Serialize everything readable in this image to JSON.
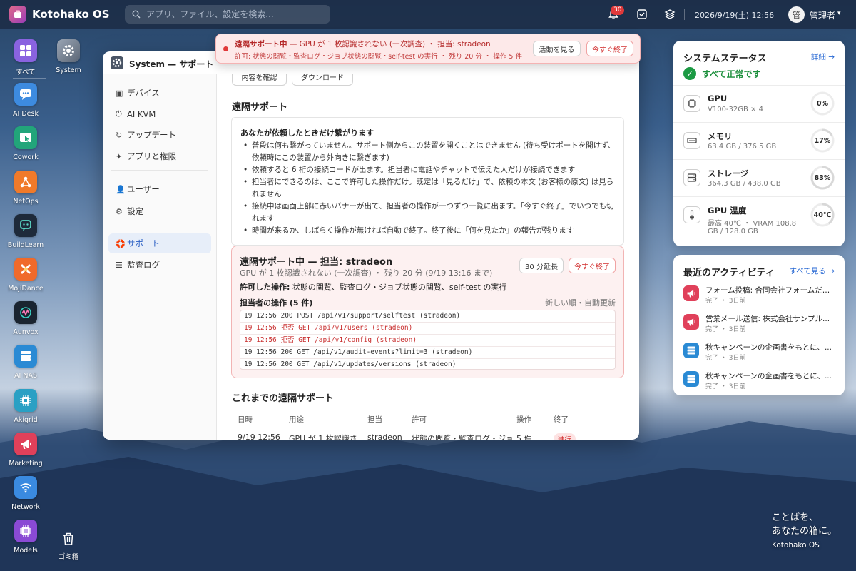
{
  "os": {
    "brand": "Kotohako OS",
    "search_placeholder": "アプリ、ファイル、設定を検索...",
    "notif_count": "30",
    "clock": "2026/9/19(土) 12:56",
    "user_avatar": "管",
    "user_name": "管理者"
  },
  "desktop": {
    "system_icon": "System",
    "trash": "ゴミ箱",
    "slogan_line1": "ことばを、",
    "slogan_line2": "あなたの箱に。",
    "slogan_sub": "Kotohako OS"
  },
  "dock": [
    {
      "label": "すべて",
      "icon": "grid-icon",
      "color": "#8a63e0"
    },
    {
      "label": "AI Desk",
      "icon": "chat-icon",
      "color": "#3d8be0"
    },
    {
      "label": "Cowork",
      "icon": "cursor-icon",
      "color": "#22a57a"
    },
    {
      "label": "NetOps",
      "icon": "network-icon",
      "color": "#f07a2a"
    },
    {
      "label": "BuildLearn",
      "icon": "build-icon",
      "color": "#1e2a3a"
    },
    {
      "label": "MojiDance",
      "icon": "dance-icon",
      "color": "#f06a2a"
    },
    {
      "label": "Aunvox",
      "icon": "wave-icon",
      "color": "#1a2430"
    },
    {
      "label": "AI NAS",
      "icon": "nas-icon",
      "color": "#2a8ad4"
    },
    {
      "label": "Akigrid",
      "icon": "chip-icon",
      "color": "#2aa0c4"
    },
    {
      "label": "Marketing",
      "icon": "megaphone-icon",
      "color": "#e0405a"
    },
    {
      "label": "Network",
      "icon": "wifi-icon",
      "color": "#3a8ae0"
    },
    {
      "label": "Models",
      "icon": "cpu-icon",
      "color": "#8a4ad4"
    }
  ],
  "banner": {
    "title": "遠隔サポート中",
    "text": " — GPU が 1 枚認識されない (一次調査) ・ 担当: stradeon",
    "line2": "許可: 状態の閲覧・監査ログ・ジョブ状態の閲覧・self-test の実行 ・ 残り 20 分 ・ 操作 5 件",
    "view_btn": "活動を見る",
    "end_btn": "今すぐ終了"
  },
  "window": {
    "title": "System — サポート"
  },
  "sidebar": {
    "items": [
      {
        "label": "デバイス",
        "icon": "▣"
      },
      {
        "label": "AI KVM",
        "icon": "⏻"
      },
      {
        "label": "アップデート",
        "icon": "↻"
      },
      {
        "label": "アプリと権限",
        "icon": "✦"
      },
      {
        "label": "ユーザー",
        "icon": "👤"
      },
      {
        "label": "設定",
        "icon": "⚙"
      },
      {
        "label": "サポート",
        "icon": "🛟"
      },
      {
        "label": "監査ログ",
        "icon": "☰"
      }
    ]
  },
  "main": {
    "top_btn1": "内容を確認",
    "top_btn2": "ダウンロード",
    "section_title": "遠隔サポート",
    "info_title": "あなたが依頼したときだけ繋がります",
    "bullets": [
      "普段は何も繋がっていません。サポート側からこの装置を開くことはできません (待ち受けポートを開けず、依頼時にこの装置から外向きに繋ぎます)",
      "依頼すると 6 桁の接続コードが出ます。担当者に電話やチャットで伝えた人だけが接続できます",
      "担当者にできるのは、ここで許可した操作だけ。既定は「見るだけ」で、依頼の本文 (お客様の原文) は見られません",
      "接続中は画面上部に赤いバナーが出て、担当者の操作が一つずつ一覧に出ます。「今すぐ終了」でいつでも切れます",
      "時間が来るか、しばらく操作が無ければ自動で終了。終了後に「何を見たか」の報告が残ります"
    ],
    "session": {
      "title": "遠隔サポート中 — 担当: stradeon",
      "sub": "GPU が 1 枚認識されない (一次調査) ・ 残り 20 分 (9/19 13:16 まで)",
      "perm_label": "許可した操作:",
      "perm_value": " 状態の閲覧、監査ログ・ジョブ状態の閲覧、self-test の実行",
      "extend_btn": "30 分延長",
      "end_btn": "今すぐ終了",
      "ops_title": "担当者の操作 (5 件)",
      "ops_note": "新しい順・自動更新",
      "log": [
        {
          "text": "19 12:56 200 POST /api/v1/support/selftest (stradeon)",
          "denied": false
        },
        {
          "text": "19 12:56 拒否 GET /api/v1/users (stradeon)",
          "denied": true
        },
        {
          "text": "19 12:56 拒否 GET /api/v1/config (stradeon)",
          "denied": true
        },
        {
          "text": "19 12:56 200 GET /api/v1/audit-events?limit=3 (stradeon)",
          "denied": false
        },
        {
          "text": "19 12:56 200 GET /api/v1/updates/versions (stradeon)",
          "denied": false
        }
      ]
    },
    "history_title": "これまでの遠隔サポート",
    "history_headers": [
      "日時",
      "用途",
      "担当",
      "許可",
      "操作",
      "終了"
    ],
    "history_rows": [
      [
        "9/19 12:56",
        "GPU が 1 枚認識さ",
        "stradeon",
        "状態の閲覧・監査ログ・ジョ",
        "5 件",
        "進行"
      ]
    ]
  },
  "status_panel": {
    "title": "システムステータス",
    "link": "詳細 →",
    "ok_text": "すべて正常です",
    "items": [
      {
        "name": "GPU",
        "sub": "V100-32GB × 4",
        "value": "0%",
        "percent": 0,
        "icon": "gpu-icon"
      },
      {
        "name": "メモリ",
        "sub": "63.4 GB / 376.5 GB",
        "value": "17%",
        "percent": 17,
        "icon": "memory-icon"
      },
      {
        "name": "ストレージ",
        "sub": "364.3 GB / 438.0 GB",
        "value": "83%",
        "percent": 83,
        "icon": "storage-icon"
      },
      {
        "name": "GPU 温度",
        "sub": "最高 40℃ ・ VRAM 108.8",
        "sub2": "GB / 128.0 GB",
        "value": "40℃",
        "percent": 40,
        "icon": "thermometer-icon"
      }
    ]
  },
  "activity_panel": {
    "title": "最近のアクティビティ",
    "link": "すべて見る →",
    "items": [
      {
        "title": "フォーム投稿: 合同会社フォームだけ...",
        "sub": "完了 ・ 3日前",
        "icon": "megaphone-icon",
        "color": "#e0405a"
      },
      {
        "title": "営業メール送信: 株式会社サンプル...",
        "sub": "完了 ・ 3日前",
        "icon": "megaphone-icon",
        "color": "#e0405a"
      },
      {
        "title": "秋キャンペーンの企画書をもとに、...",
        "sub": "完了 ・ 3日前",
        "icon": "nas-icon",
        "color": "#2a8ad4"
      },
      {
        "title": "秋キャンペーンの企画書をもとに、...",
        "sub": "完了 ・ 3日前",
        "icon": "nas-icon",
        "color": "#2a8ad4"
      }
    ]
  }
}
